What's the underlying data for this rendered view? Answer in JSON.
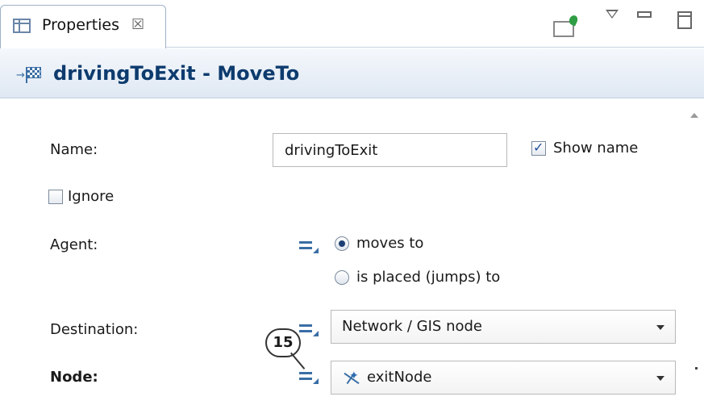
{
  "tab": {
    "label": "Properties",
    "close_glyph": "☒"
  },
  "header": {
    "title": "drivingToExit - MoveTo"
  },
  "form": {
    "name_label": "Name:",
    "name_value": "drivingToExit",
    "show_name_label": "Show name",
    "show_name_checked": true,
    "ignore_label": "Ignore",
    "ignore_checked": false,
    "agent_label": "Agent:",
    "agent_options": [
      "moves to",
      "is placed (jumps) to"
    ],
    "agent_selected": "moves to",
    "destination_label": "Destination:",
    "destination_value": "Network / GIS node",
    "node_label": "Node:",
    "node_value": "exitNode"
  },
  "callout": {
    "number": "15"
  },
  "icons": {
    "tab": "properties-table-icon",
    "pin": "pin-to-view-icon",
    "menu": "view-menu-icon",
    "minimize": "minimize-icon",
    "maximize": "maximize-icon",
    "header": "moveto-block-icon",
    "dynamic": "dynamic-value-icon",
    "node": "network-node-icon"
  }
}
